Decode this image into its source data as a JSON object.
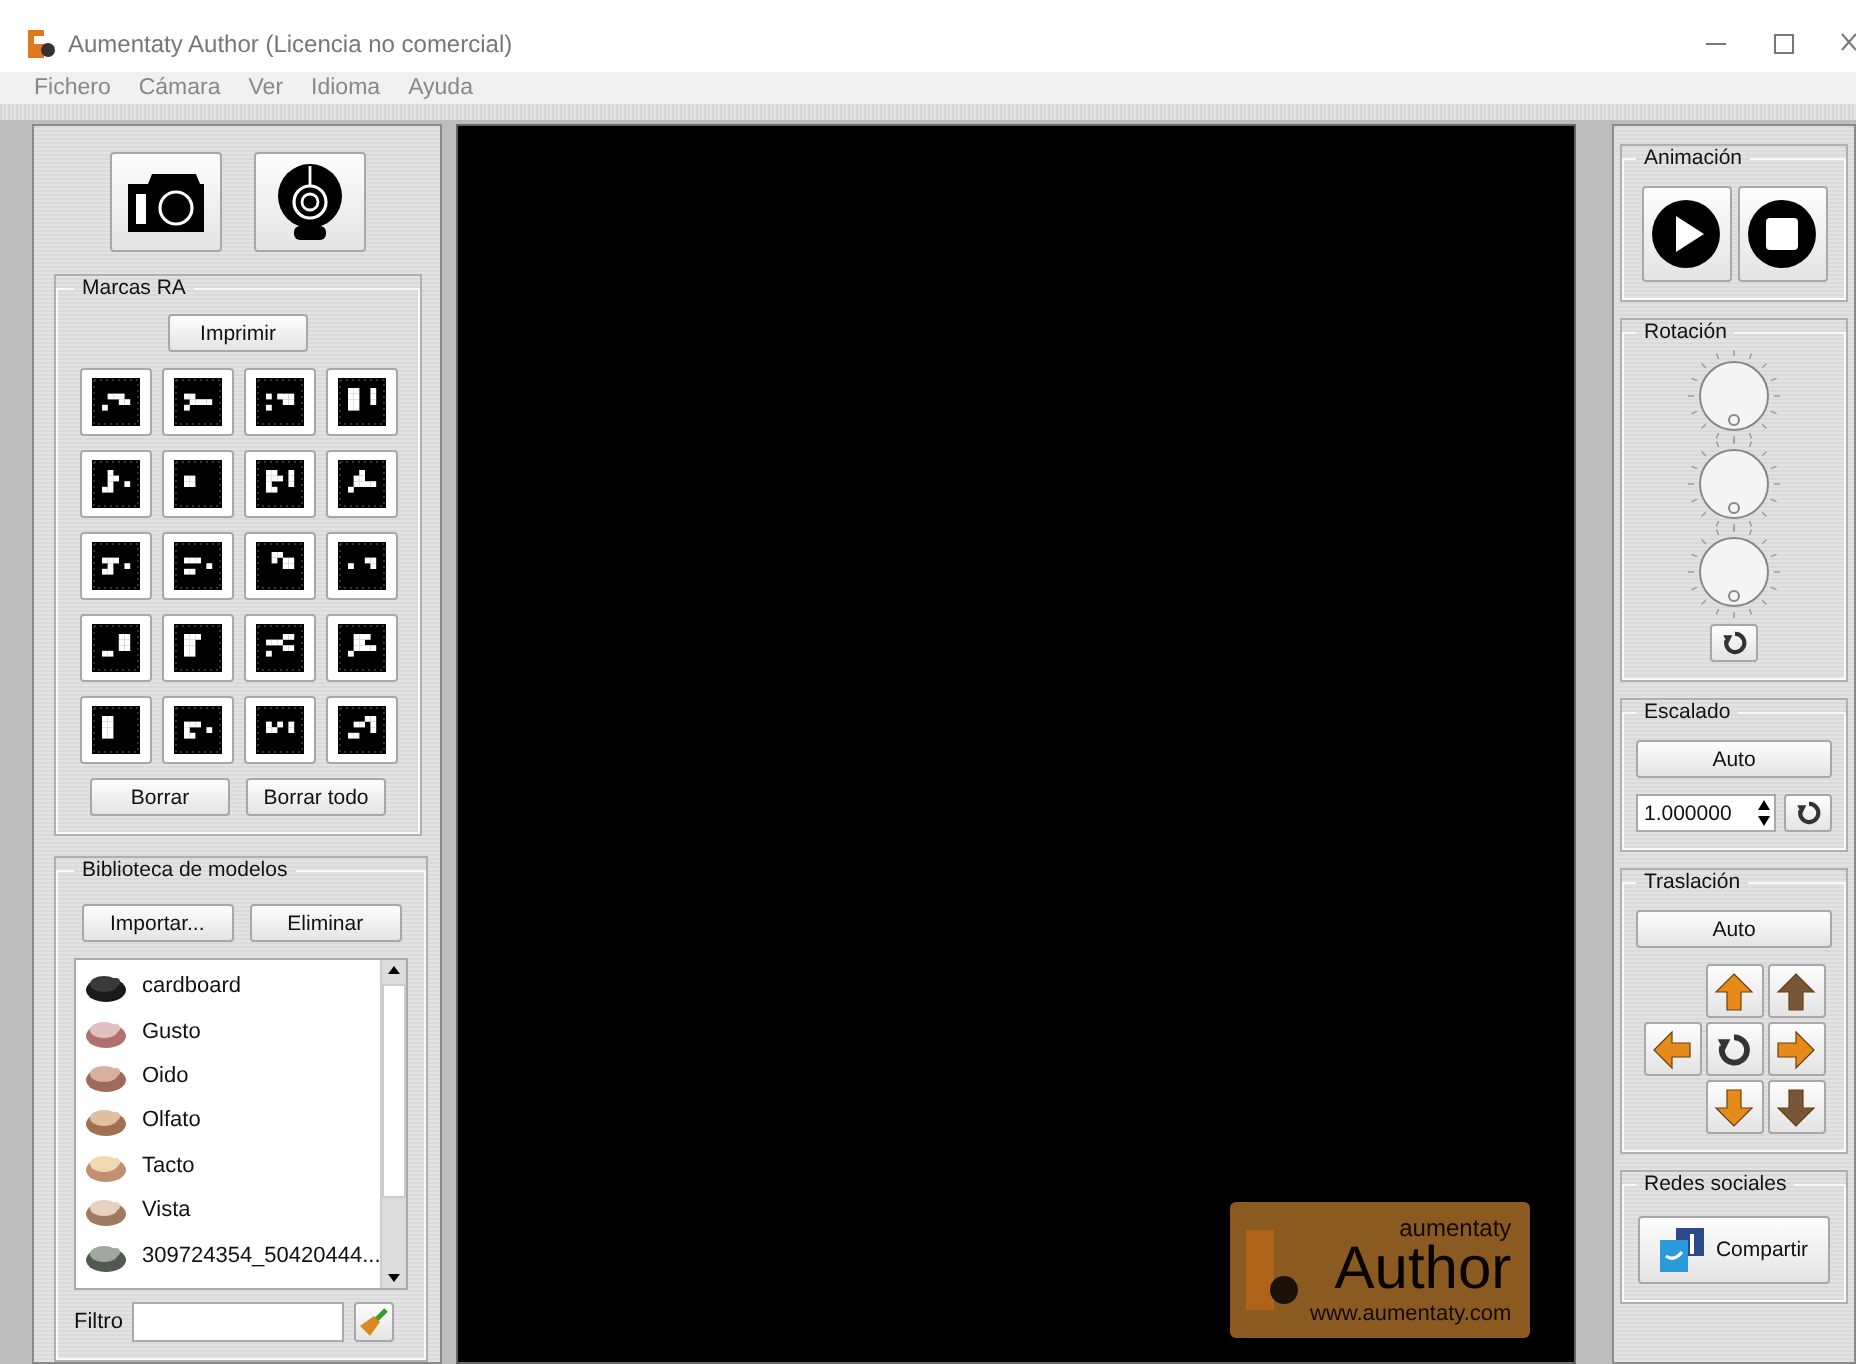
{
  "window": {
    "title": "Aumentaty Author (Licencia no comercial)"
  },
  "menu": [
    "Fichero",
    "Cámara",
    "Ver",
    "Idioma",
    "Ayuda"
  ],
  "markers_group": {
    "title": "Marcas RA",
    "print_button": "Imprimir",
    "buttons": [
      "Borrar",
      "Borrar todo"
    ]
  },
  "library": {
    "title": "Biblioteca de modelos",
    "buttons": [
      "Importar...",
      "Eliminar"
    ],
    "filter_label": "Filtro",
    "models": [
      {
        "name": "cardboard"
      },
      {
        "name": "Gusto"
      },
      {
        "name": "Oido"
      },
      {
        "name": "Olfato"
      },
      {
        "name": "Tacto"
      },
      {
        "name": "Vista"
      },
      {
        "name": "309724354_50420444..."
      }
    ]
  },
  "viewport_logo": {
    "brand": "aumentaty",
    "product": "Author",
    "url": "www.aumentaty.com"
  },
  "animation": {
    "title": "Animación"
  },
  "rotation": {
    "title": "Rotación"
  },
  "scaling": {
    "title": "Escalado",
    "auto_button": "Auto",
    "value": "1.000000"
  },
  "translation": {
    "title": "Traslación",
    "auto_button": "Auto"
  },
  "social": {
    "title": "Redes sociales",
    "share_button": "Compartir"
  }
}
